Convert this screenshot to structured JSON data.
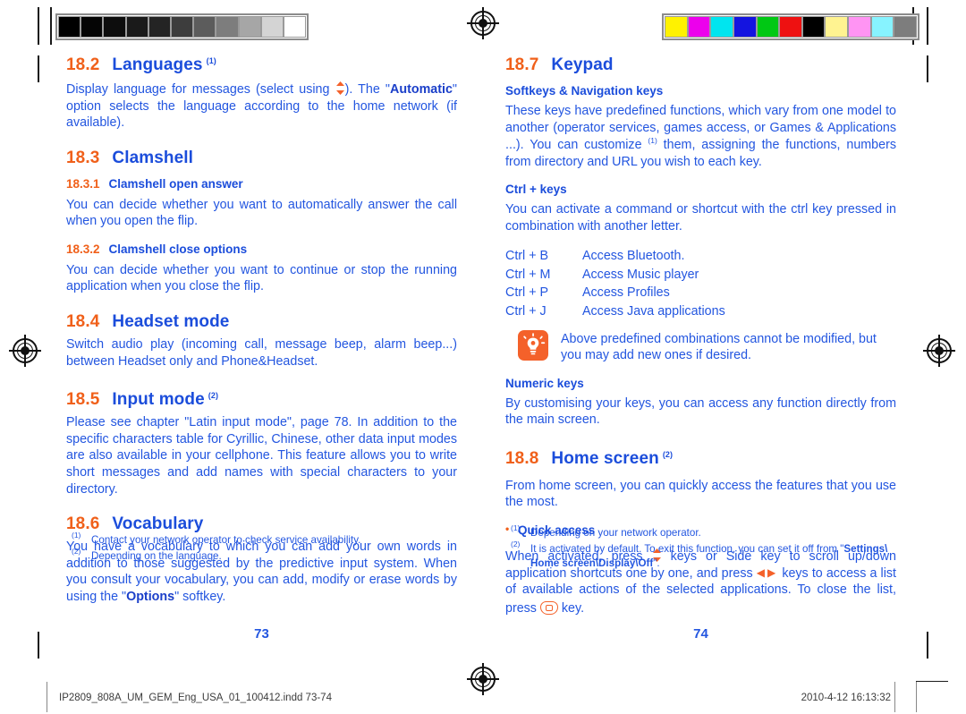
{
  "print_marks": {
    "gray_bar_name": "grayscale-step-wedge",
    "gray_patches": [
      "#000000",
      "#050505",
      "#0d0d0d",
      "#1a1a1a",
      "#242424",
      "#3d3d3d",
      "#5c5c5c",
      "#7d7d7d",
      "#a6a6a6",
      "#d4d4d4",
      "#ffffff"
    ],
    "color_bar_name": "cmyk-color-control-bar",
    "color_patches": [
      "#fff200",
      "#ec00ec",
      "#00e5ef",
      "#1414e0",
      "#00c814",
      "#ee1111",
      "#000000",
      "#fff391",
      "#ff94f3",
      "#87f3ff",
      "#7d7d7d"
    ],
    "registration_mark_name": "registration-target"
  },
  "left_column": {
    "sections": [
      {
        "number": "18.2",
        "title": "Languages",
        "superscript": "(1)",
        "body_html": "Display language for messages (select using <span class=\"gl-updown\" data-name=\"updown-arrow-icon\" data-interactable=\"false\"><svg width=\"11\" height=\"15\" viewBox=\"0 0 11 15\"><polygon points=\"5.5,0 10,5 1,5\" fill=\"#f4612a\"/><polygon points=\"5.5,15 10,10 1,10\" fill=\"#f4612a\"/></svg></span>). The \"<b>Automatic</b>\" option selects the language according to the home network (if available)."
      },
      {
        "number": "18.3",
        "title": "Clamshell",
        "superscript": "",
        "subsections": [
          {
            "number": "18.3.1",
            "title": "Clamshell open answer",
            "body_html": "You can decide whether you want to automatically answer the call when you open the flip."
          },
          {
            "number": "18.3.2",
            "title": "Clamshell close options",
            "body_html": "You can decide whether you want to continue or stop the running application when you close the flip."
          }
        ]
      },
      {
        "number": "18.4",
        "title": "Headset mode",
        "superscript": "",
        "body_html": "Switch audio play (incoming call, message beep, alarm beep...) between Headset only and Phone&amp;Headset."
      },
      {
        "number": "18.5",
        "title": "Input mode",
        "superscript": "(2)",
        "body_html": "Please see chapter \"Latin input mode\", page 78. In addition to the specific characters table for Cyrillic, Chinese, other data input modes are also available in your cellphone. This feature allows you to write short messages and add names with special characters to your directory."
      },
      {
        "number": "18.6",
        "title": "Vocabulary",
        "superscript": "",
        "body_html": "You have a vocabulary to which you can add your own words in addition to those suggested by the predictive input system. When you consult your vocabulary, you can add, modify or erase words by using the \"<b>Options</b>\" softkey."
      }
    ],
    "footnotes": [
      {
        "mark": "(1)",
        "text_html": "Contact your network operator to check service availability."
      },
      {
        "mark": "(2)",
        "text_html": "Depending on the language."
      }
    ],
    "folio": "73"
  },
  "right_column": {
    "sections": [
      {
        "number": "18.7",
        "title": "Keypad",
        "superscript": "",
        "blocks": [
          {
            "kind": "h4",
            "title": "Softkeys &amp; Navigation keys"
          },
          {
            "kind": "p",
            "body_html": "These keys have predefined functions, which vary from one model to another (operator services, games access, or Games &amp; Applications ...). You can customize <sup style=\"font-size:8.5px\">(1)</sup> them, assigning the functions, numbers from directory and URL you wish to each key."
          },
          {
            "kind": "h4",
            "title": "Ctrl + keys"
          },
          {
            "kind": "p",
            "body_html": "You can activate a command or shortcut with the ctrl key pressed in combination with another letter."
          },
          {
            "kind": "ctrl-list"
          },
          {
            "kind": "tip",
            "tip_text": "Above predefined combinations cannot be modified, but you may add new ones if desired."
          },
          {
            "kind": "h4",
            "title": "Numeric keys"
          },
          {
            "kind": "p",
            "body_html": "By customising your keys, you can access any function directly from the main screen."
          }
        ]
      },
      {
        "number": "18.8",
        "title": "Home screen",
        "superscript": "(2)",
        "blocks": [
          {
            "kind": "p",
            "body_html": "From home screen, you can quickly access the features that you use the most."
          },
          {
            "kind": "bullet-h",
            "title": "Quick access"
          },
          {
            "kind": "p",
            "body_html": "When activated, press <span class=\"gl-updown\" data-name=\"updown-arrow-icon\" data-interactable=\"false\"><svg width=\"11\" height=\"15\" viewBox=\"0 0 11 15\"><polygon points=\"5.5,0 10,5 1,5\" fill=\"#f4612a\"/><polygon points=\"5.5,15 10,10 1,10\" fill=\"#f4612a\"/></svg></span> keys or Side key to scroll up/down application shortcuts one by one, and press <span class=\"gl-lr\" data-name=\"leftright-arrow-icon\" data-interactable=\"false\">◀▶</span> keys to access a list of available actions of the selected applications. To close the list, press <span class=\"gl-key\" data-name=\"back-key-icon\" data-interactable=\"false\"></span> key."
          }
        ]
      }
    ],
    "ctrl_shortcuts": [
      {
        "combo": "Ctrl + B",
        "desc": "Access Bluetooth."
      },
      {
        "combo": "Ctrl + M",
        "desc": "Access Music player"
      },
      {
        "combo": "Ctrl + P",
        "desc": "Access Profiles"
      },
      {
        "combo": "Ctrl + J",
        "desc": "Access Java applications"
      }
    ],
    "footnotes": [
      {
        "mark": "(1)",
        "text_html": "Depending on your network operator."
      },
      {
        "mark": "(2)",
        "text_html": "It is activated by default. To exit this function, you can set it off from \"<b>Settings\\ Home screen\\Display\\Off</b>\"."
      }
    ],
    "folio": "74"
  },
  "slug": {
    "filename": "IP2809_808A_UM_GEM_Eng_USA_01_100412.indd   73-74",
    "datetime": "2010-4-12   16:13:32"
  },
  "colors": {
    "heading_orange": "#f0601a",
    "heading_blue": "#1b4ddb",
    "body_blue": "#2356e0",
    "tip_orange": "#f4612a"
  }
}
